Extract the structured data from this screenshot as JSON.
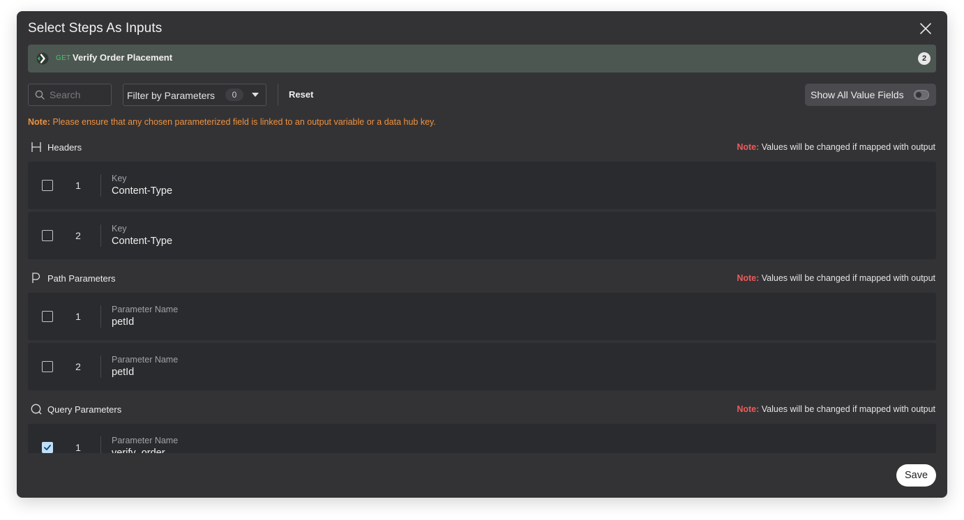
{
  "modal": {
    "title": "Select Steps As Inputs",
    "save_label": "Save"
  },
  "step": {
    "method": "GET",
    "name": "Verify Order Placement",
    "count": "2"
  },
  "toolbar": {
    "search_placeholder": "Search",
    "filter_label": "Filter by Parameters",
    "filter_count": "0",
    "reset_label": "Reset",
    "show_all_label": "Show All Value Fields",
    "show_all_enabled": false
  },
  "global_note": {
    "label": "Note:",
    "text": "Please ensure that any chosen parameterized field is linked to an output variable or a data hub key."
  },
  "sections": {
    "headers": {
      "title": "Headers",
      "icon": "header-h-icon",
      "note_label": "Note:",
      "note_text": "Values will be changed if mapped with output",
      "rows": [
        {
          "index": "1",
          "label": "Key",
          "value": "Content-Type",
          "checked": false
        },
        {
          "index": "2",
          "label": "Key",
          "value": "Content-Type",
          "checked": false
        }
      ]
    },
    "path": {
      "title": "Path Parameters",
      "icon": "path-p-icon",
      "note_label": "Note:",
      "note_text": "Values will be changed if mapped with output",
      "rows": [
        {
          "index": "1",
          "label": "Parameter Name",
          "value": "petId",
          "checked": false
        },
        {
          "index": "2",
          "label": "Parameter Name",
          "value": "petId",
          "checked": false
        }
      ]
    },
    "query": {
      "title": "Query Parameters",
      "icon": "query-q-icon",
      "note_label": "Note:",
      "note_text": "Values will be changed if mapped with output",
      "rows": [
        {
          "index": "1",
          "label": "Parameter Name",
          "value": "verify_order",
          "checked": true
        }
      ]
    }
  },
  "colors": {
    "modal_bg": "#333336",
    "step_bar_bg": "#4d5751",
    "method_green": "#46c46e",
    "note_orange": "#f0913c",
    "note_red": "#ef5a5a",
    "checkbox_checked": "#bfe0f7"
  }
}
